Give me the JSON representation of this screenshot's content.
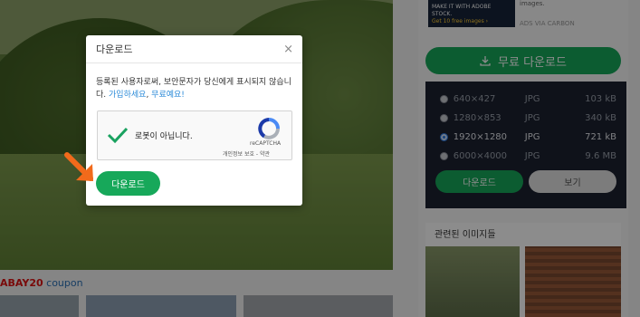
{
  "ad": {
    "line1": "MAKE IT WITH ADOBE STOCK.",
    "line2": "Get 10 free images ›",
    "side_text": "images.",
    "via": "ADS VIA CARBON"
  },
  "free_download": {
    "label": "무료 다운로드"
  },
  "sizes": [
    {
      "dim": "640×427",
      "fmt": "JPG",
      "kb": "103 kB",
      "selected": false
    },
    {
      "dim": "1280×853",
      "fmt": "JPG",
      "kb": "340 kB",
      "selected": false
    },
    {
      "dim": "1920×1280",
      "fmt": "JPG",
      "kb": "721 kB",
      "selected": true
    },
    {
      "dim": "6000×4000",
      "fmt": "JPG",
      "kb": "9.6 MB",
      "selected": false
    }
  ],
  "size_panel": {
    "download_label": "다운로드",
    "view_label": "보기"
  },
  "related": {
    "heading": "관련된 이미지들"
  },
  "coupon": {
    "code": "ABAY20",
    "word": "coupon"
  },
  "modal": {
    "title": "다운로드",
    "close": "×",
    "message_prefix": "등록된 사용자로써, 보안문자가 당신에게 표시되지 않습니다.",
    "signup_link": "가입하세요",
    "free_link": "무료예요!",
    "captcha_label": "로봇이 아닙니다.",
    "captcha_brand": "reCAPTCHA",
    "captcha_links": "개인정보 보호 - 약관",
    "download_label": "다운로드"
  },
  "colors": {
    "accent_green": "#17a85a",
    "link_blue": "#2a8ad8",
    "arrow_orange": "#f26a1b",
    "panel_dark": "#1d2230"
  }
}
